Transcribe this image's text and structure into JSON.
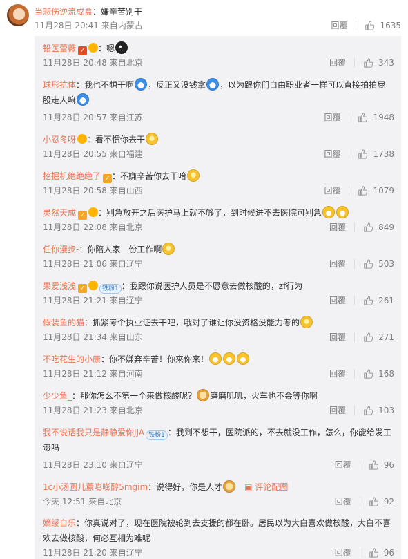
{
  "top_comment": {
    "user": "当悲伤逆流成盒",
    "separator": "：",
    "text": "嫌辛苦别干",
    "time": "11月28日 20:41",
    "location": "来自内蒙古",
    "reply": "回覆",
    "likes": "1635"
  },
  "replies": [
    {
      "user": "铅医蕾薇",
      "badges": [
        "vip-red",
        "lvl"
      ],
      "sep": "：",
      "text": "嗯",
      "emoji": [
        "dark"
      ],
      "time": "11月28日 20:48",
      "location": "来自北京",
      "reply": "回覆",
      "likes": "343"
    },
    {
      "user": "球形抗体",
      "badges": [],
      "sep": "：",
      "text": "我也不想干啊",
      "emoji": [
        "blue"
      ],
      "text2": "，反正又没钱拿",
      "emoji2": [
        "blue"
      ],
      "text3": "，以为跟你们自由职业者一样可以直接拍拍屁股走人嘛",
      "emoji3": [
        "blue"
      ],
      "time": "11月28日 20:57",
      "location": "来自江苏",
      "reply": "回覆",
      "likes": "1948"
    },
    {
      "user": "小忍冬呀",
      "badges": [
        "lvl"
      ],
      "sep": "：",
      "text": "看不惯你去干",
      "emoji": [
        "yellow"
      ],
      "time": "11月28日 20:55",
      "location": "来自福建",
      "reply": "回覆",
      "likes": "1738"
    },
    {
      "user": "挖掘机绝绝绝了",
      "badges": [
        "vip"
      ],
      "sep": "：",
      "text": "不嫌辛苦你去干哈",
      "emoji": [
        "yellow"
      ],
      "time": "11月28日 20:58",
      "location": "来自山西",
      "reply": "回覆",
      "likes": "1079"
    },
    {
      "user": "灵然天成",
      "badges": [
        "vip",
        "lvl"
      ],
      "sep": "：",
      "text": "别急放开之后医护马上就不够了，到时候进不去医院可别急",
      "emoji": [
        "grin",
        "grin"
      ],
      "time": "11月28日 22:08",
      "location": "来自北京",
      "reply": "回覆",
      "likes": "849"
    },
    {
      "user": "任你漫步-",
      "badges": [],
      "sep": "：",
      "text": "你陪人家一份工作啊",
      "emoji": [
        "yellow"
      ],
      "time": "11月28日 21:06",
      "location": "来自辽宁",
      "reply": "回覆",
      "likes": "503"
    },
    {
      "user": "果爱浅浅",
      "badges": [
        "vip",
        "lvl"
      ],
      "fan": "铁粉1",
      "sep": "：",
      "text": "我跟你说医护人员是不愿意去做核酸的，zf行为",
      "emoji": [],
      "time": "11月28日 21:21",
      "location": "来自辽宁",
      "reply": "回覆",
      "likes": "261"
    },
    {
      "user": "假装鱼的猫",
      "badges": [],
      "sep": "：",
      "text": "抓紧考个执业证去干吧，哦对了谁让你没资格没能力考的",
      "emoji": [
        "yellow"
      ],
      "time": "11月28日 21:34",
      "location": "来自山东",
      "reply": "回覆",
      "likes": "271"
    },
    {
      "user": "不吃花生的小康",
      "badges": [],
      "sep": "：",
      "text": "你不嫌弃辛苦！你来你来！",
      "emoji": [
        "grin",
        "grin",
        "grin"
      ],
      "time": "11月28日 21:12",
      "location": "来自河南",
      "reply": "回覆",
      "likes": "168"
    },
    {
      "user": "少少鱼_",
      "badges": [],
      "sep": "：",
      "text": "那你怎么不第一个来做核酸呢？",
      "emoji": [
        "face"
      ],
      "text2": "磨磨叽叽，火车也不会等你啊",
      "time": "11月28日 21:23",
      "location": "来自北京",
      "reply": "回覆",
      "likes": "103"
    },
    {
      "user": "我不说话我只是静静爱你JJA",
      "badges": [],
      "fan": "铁粉1",
      "sep": "：",
      "text": "我到不想干，医院派的，不去就没工作，怎么，你能给发工资吗",
      "emoji": [],
      "time": "11月28日 23:10",
      "location": "来自辽宁",
      "reply": "回覆",
      "likes": "96"
    },
    {
      "user": "1c小汤圆儿薰嘭嘭醇5mgim",
      "badges": [],
      "sep": "：",
      "text": "说得好，你是人才",
      "emoji": [
        "face"
      ],
      "link": "评论配图",
      "time": "今天 12:51",
      "location": "来自北京",
      "reply": "回覆",
      "likes": "92"
    },
    {
      "user": "嫡绥自乐",
      "badges": [],
      "sep": "：",
      "text": "你真说对了，现在医院被轮到去支援的都在卧。居民以为大白喜欢做核酸，大白不喜欢去做核酸，何必互相为难呢",
      "emoji": [],
      "time": "11月28日 21:20",
      "location": "来自辽宁",
      "reply": "回覆",
      "likes": "96"
    }
  ],
  "icons": {
    "like": "thumbs-up-icon",
    "link": "image-link-icon"
  },
  "colors": {
    "username": "#eb7350",
    "meta": "#808080",
    "panel": "#f2f2f5"
  }
}
